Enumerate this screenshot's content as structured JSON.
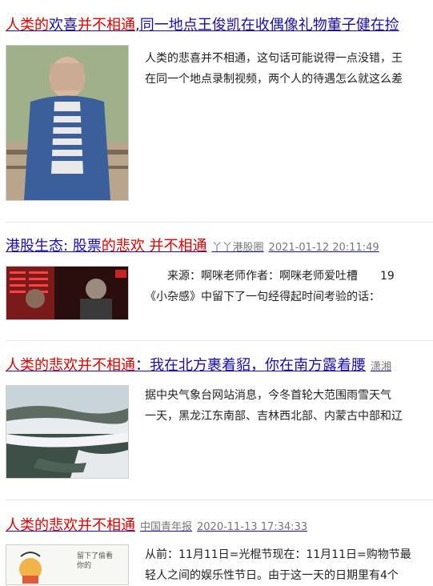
{
  "results": [
    {
      "title_parts": [
        {
          "text": "人类的",
          "hl": true
        },
        {
          "text": "欢喜",
          "hl": false
        },
        {
          "text": "并不相通",
          "hl": true
        },
        {
          "text": ",同一地点王俊凯在收偶像礼物董子健在捡",
          "hl": false
        }
      ],
      "source": "",
      "date": "",
      "snippet_lines": [
        "人类的悲喜并不相通，这句话可能说得一点没错，王",
        "在同一个地点录制视频，两个人的待遇怎么就这么差"
      ],
      "thumb_alt": "person-photo"
    },
    {
      "title_parts": [
        {
          "text": "港股生态: 股票",
          "hl": false
        },
        {
          "text": "的悲欢 并不相通",
          "hl": true
        }
      ],
      "source": "丫丫港股圈",
      "date": "2021-01-12 20:11:49",
      "snippet_lines": [
        "　　来源：啊咪老师作者：啊咪老师爱吐槽　　19",
        "《小杂感》中留下了一句经得起时间考验的话："
      ],
      "thumb_alt": "stock-screen-photo"
    },
    {
      "title_parts": [
        {
          "text": "人类的悲欢并不相通",
          "hl": true
        },
        {
          "text": "：我在北方裹着貂，你在南方露着腰",
          "hl": false
        }
      ],
      "source": "潇湘",
      "date": "",
      "snippet_lines": [
        "据中央气象台网站消息，今冬首轮大范围雨雪天气",
        "一天，黑龙江东南部、吉林西北部、内蒙古中部和辽"
      ],
      "thumb_alt": "snow-lake-photo"
    },
    {
      "title_parts": [
        {
          "text": "人类的悲欢并不相通",
          "hl": true
        }
      ],
      "source": "中国青年报",
      "date": "2020-11-13 17:34:33",
      "snippet_lines": [
        "从前：11月11日=光棍节现在：11月11日=购物节最",
        "轻人之间的娱乐性节日。由于这一天的日期里有4个"
      ],
      "thumb_alt": "illustration",
      "thumb_text": "留下了偷看你的"
    }
  ],
  "colors": {
    "link": "#1a0dab",
    "highlight": "#e00000",
    "meta": "#777777"
  }
}
